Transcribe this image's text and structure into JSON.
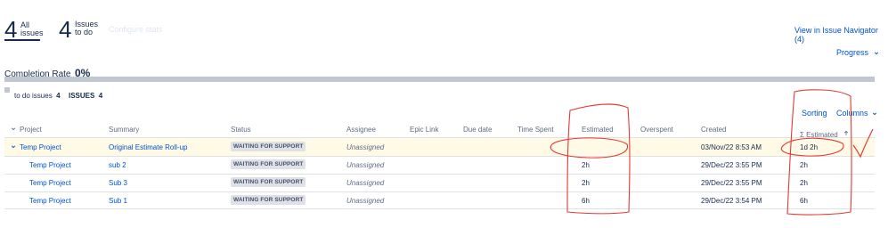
{
  "stats": [
    {
      "number": "4",
      "label_line1": "All",
      "label_line2": "issues",
      "selected": true
    },
    {
      "number": "4",
      "label_line1": "Issues",
      "label_line2": "to do",
      "selected": false
    }
  ],
  "configure_link": "Configure stats",
  "view_in_navigator": "View in Issue Navigator (4)",
  "progress_menu": "Progress",
  "completion": {
    "label": "Completion Rate",
    "value": "0%",
    "progress": 0
  },
  "legend": {
    "todo": "to do issues",
    "todo_count": "4",
    "issues_label": "ISSUES",
    "issues_count": "4"
  },
  "toolbar": {
    "sorting": "Sorting",
    "columns": "Columns"
  },
  "table": {
    "headers": {
      "project": "Project",
      "summary": "Summary",
      "status": "Status",
      "assignee": "Assignee",
      "epic_link": "Epic Link",
      "due_date": "Due date",
      "time_spent": "Time Spent",
      "estimated": "Estimated",
      "overspent": "Overspent",
      "created": "Created",
      "sum_estimated": "Σ Estimated"
    },
    "rows": [
      {
        "project": "Temp Project",
        "summary": "Original Estimate Roll-up",
        "status": "WAITING FOR SUPPORT",
        "assignee": "Unassigned",
        "epic_link": "",
        "due_date": "",
        "time_spent": "",
        "estimated": "",
        "overspent": "",
        "created": "03/Nov/22 8:53 AM",
        "sum_estimated": "1d 2h",
        "parent": true
      },
      {
        "project": "Temp Project",
        "summary": "sub 2",
        "status": "WAITING FOR SUPPORT",
        "assignee": "Unassigned",
        "epic_link": "",
        "due_date": "",
        "time_spent": "",
        "estimated": "2h",
        "overspent": "",
        "created": "29/Dec/22 3:55 PM",
        "sum_estimated": "2h",
        "parent": false
      },
      {
        "project": "Temp Project",
        "summary": "Sub 3",
        "status": "WAITING FOR SUPPORT",
        "assignee": "Unassigned",
        "epic_link": "",
        "due_date": "",
        "time_spent": "",
        "estimated": "2h",
        "overspent": "",
        "created": "29/Dec/22 3:55 PM",
        "sum_estimated": "2h",
        "parent": false
      },
      {
        "project": "Temp Project",
        "summary": "Sub 1",
        "status": "WAITING FOR SUPPORT",
        "assignee": "Unassigned",
        "epic_link": "",
        "due_date": "",
        "time_spent": "",
        "estimated": "6h",
        "overspent": "",
        "created": "29/Dec/22 3:54 PM",
        "sum_estimated": "6h",
        "parent": false
      }
    ]
  },
  "colors": {
    "accent": "#0052cc",
    "highlight_row": "#fffae6",
    "annotation": "#e53935"
  }
}
